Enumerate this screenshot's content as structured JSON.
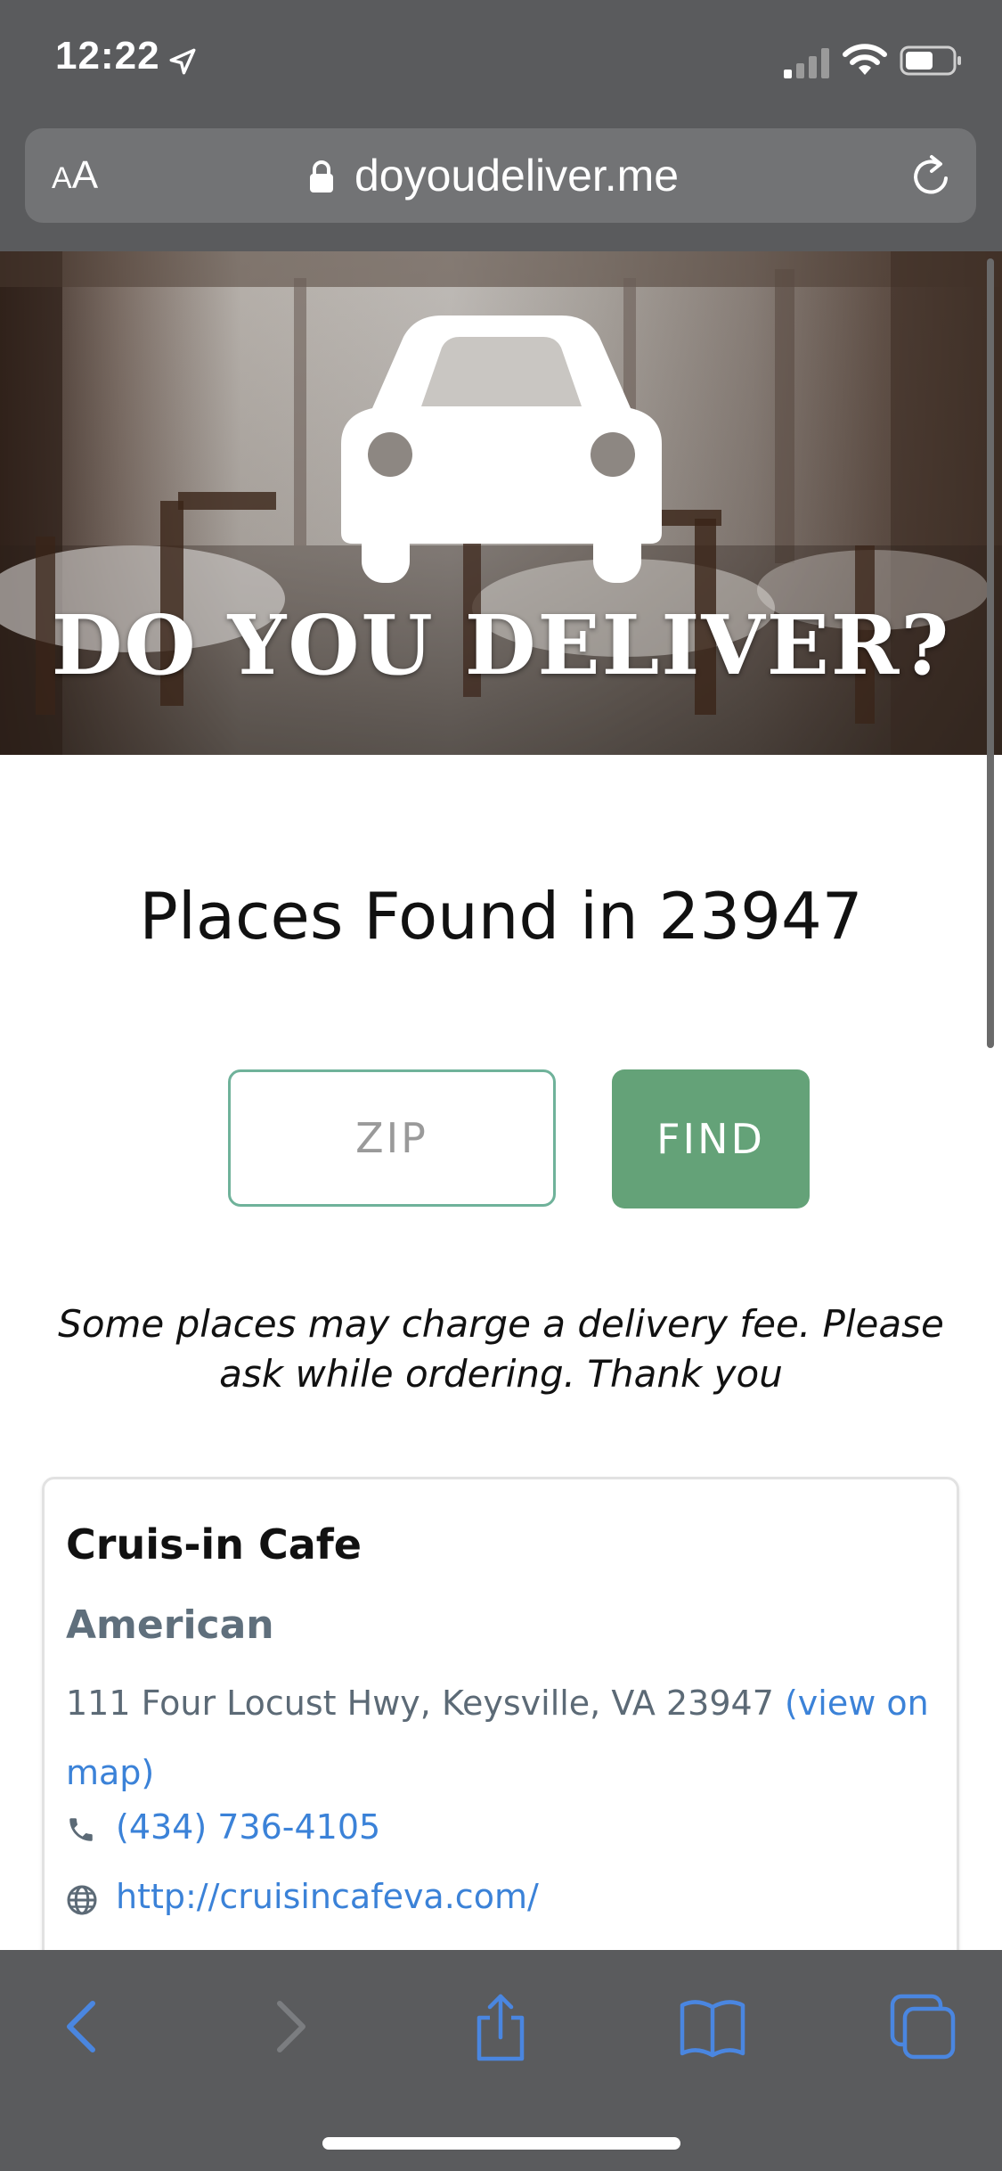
{
  "status_bar": {
    "time": "12:22",
    "icons": [
      "location-arrow-icon",
      "cellular-signal-icon",
      "wifi-icon",
      "battery-icon"
    ]
  },
  "browser": {
    "text_size_small": "A",
    "text_size_large": "A",
    "url": "doyoudeliver.me",
    "icons": [
      "lock-icon",
      "reload-icon"
    ]
  },
  "hero": {
    "title": "DO YOU DELIVER?",
    "logo_icon": "car-icon"
  },
  "main": {
    "heading": "Places Found in 23947",
    "zip_placeholder": "ZIP",
    "zip_value": "",
    "find_label": "FIND",
    "fee_note": "Some places may charge a delivery fee. Please ask while ordering. Thank you"
  },
  "results": [
    {
      "name": "Cruis-in Cafe",
      "cuisine": "American",
      "address": "111 Four Locust Hwy, Keysville, VA 23947",
      "map_link": "(view on map)",
      "phone": "(434) 736-4105",
      "website": "http://cruisincafeva.com/"
    }
  ],
  "toolbar": {
    "icons": [
      "back-icon",
      "forward-icon",
      "share-icon",
      "bookmarks-icon",
      "tabs-icon"
    ]
  },
  "colors": {
    "chrome": "#5a5b5d",
    "url_bar": "#727375",
    "accent_green": "#64a278",
    "input_border": "#6fb29a",
    "link_blue": "#3b82d8",
    "cuisine_gray": "#5f6f7c",
    "toolbar_icon_blue": "#4a86e0"
  }
}
